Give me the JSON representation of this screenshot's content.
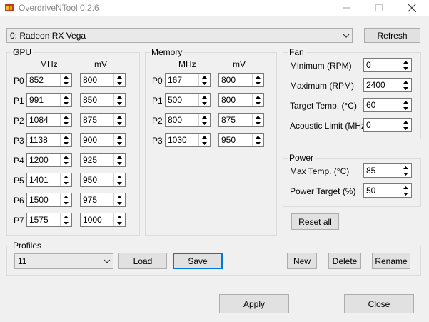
{
  "window": {
    "title": "OverdriveNTool 0.2.6"
  },
  "device": {
    "selected": "0: Radeon RX Vega",
    "refresh_label": "Refresh"
  },
  "gpu": {
    "title": "GPU",
    "col_mhz": "MHz",
    "col_mv": "mV",
    "rows": [
      {
        "label": "P0",
        "mhz": "852",
        "mv": "800"
      },
      {
        "label": "P1",
        "mhz": "991",
        "mv": "850"
      },
      {
        "label": "P2",
        "mhz": "1084",
        "mv": "875"
      },
      {
        "label": "P3",
        "mhz": "1138",
        "mv": "900"
      },
      {
        "label": "P4",
        "mhz": "1200",
        "mv": "925"
      },
      {
        "label": "P5",
        "mhz": "1401",
        "mv": "950"
      },
      {
        "label": "P6",
        "mhz": "1500",
        "mv": "975"
      },
      {
        "label": "P7",
        "mhz": "1575",
        "mv": "1000"
      }
    ]
  },
  "memory": {
    "title": "Memory",
    "col_mhz": "MHz",
    "col_mv": "mV",
    "rows": [
      {
        "label": "P0",
        "mhz": "167",
        "mv": "800"
      },
      {
        "label": "P1",
        "mhz": "500",
        "mv": "800"
      },
      {
        "label": "P2",
        "mhz": "800",
        "mv": "875"
      },
      {
        "label": "P3",
        "mhz": "1030",
        "mv": "950"
      }
    ]
  },
  "fan": {
    "title": "Fan",
    "fields": [
      {
        "label": "Minimum (RPM)",
        "value": "0"
      },
      {
        "label": "Maximum (RPM)",
        "value": "2400"
      },
      {
        "label": "Target Temp. (°C)",
        "value": "60"
      },
      {
        "label": "Acoustic Limit (MHz)",
        "value": "0"
      }
    ]
  },
  "power": {
    "title": "Power",
    "fields": [
      {
        "label": "Max Temp. (°C)",
        "value": "85"
      },
      {
        "label": "Power Target (%)",
        "value": "50"
      }
    ]
  },
  "reset_label": "Reset all",
  "profiles": {
    "title": "Profiles",
    "selected": "11",
    "load_label": "Load",
    "save_label": "Save",
    "new_label": "New",
    "delete_label": "Delete",
    "rename_label": "Rename"
  },
  "footer": {
    "apply_label": "Apply",
    "close_label": "Close"
  },
  "colors": {
    "accent": "#0078d7",
    "button_bg": "#e1e1e1",
    "window_bg": "#f0f0f0"
  }
}
